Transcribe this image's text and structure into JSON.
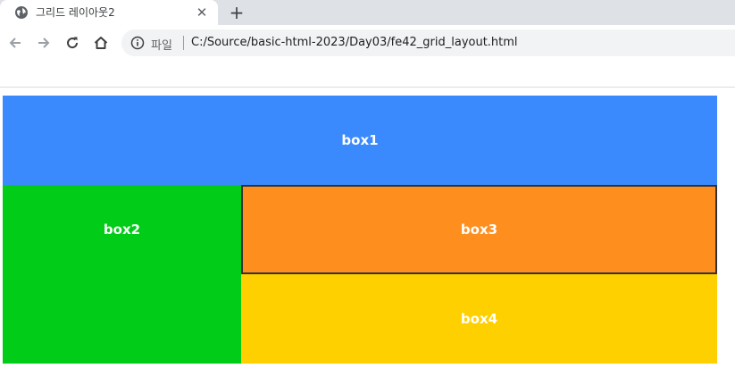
{
  "browser": {
    "tab": {
      "title": "그리드 레이아웃2",
      "favicon": "globe-icon",
      "close_icon": "close-icon"
    },
    "new_tab_icon": "plus-icon",
    "nav": {
      "back": "back-arrow-icon",
      "forward": "forward-arrow-icon",
      "reload": "reload-icon",
      "home": "home-icon"
    },
    "omnibox": {
      "info_icon": "info-icon",
      "scheme_label": "파일",
      "url": "C:/Source/basic-html-2023/Day03/fe42_grid_layout.html"
    }
  },
  "page": {
    "boxes": [
      {
        "label": "box1",
        "color": "#3a8afe"
      },
      {
        "label": "box2",
        "color": "#01cc17"
      },
      {
        "label": "box3",
        "color": "#fe8f1f"
      },
      {
        "label": "box4",
        "color": "#ffd000"
      }
    ],
    "box3_border_color": "#333333"
  }
}
